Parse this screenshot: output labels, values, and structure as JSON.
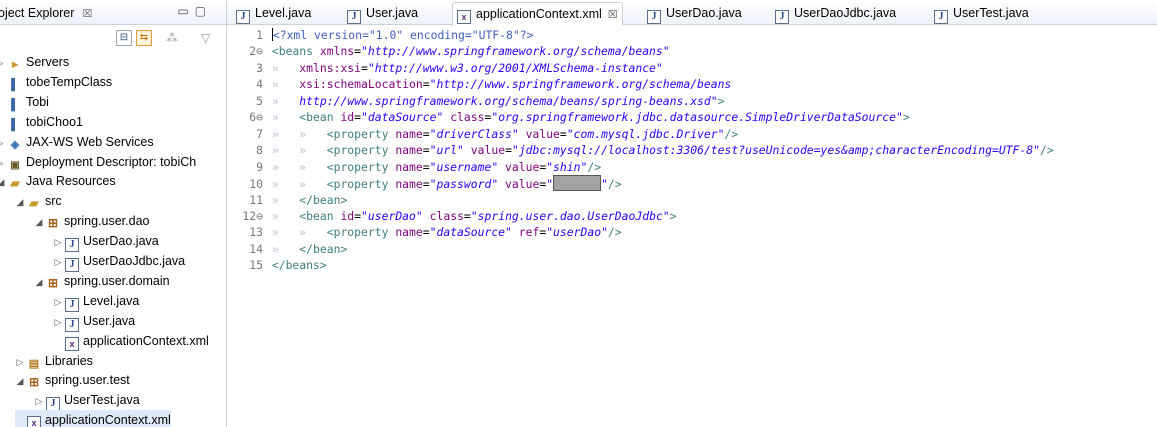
{
  "explorer": {
    "title": "oject Explorer",
    "close": "☒",
    "minimize": "▭",
    "maximize": "▢",
    "tree": [
      {
        "label": "Servers",
        "icon": "folder-icon",
        "twisty": "▹",
        "indent": 0
      },
      {
        "label": "tobeTempClass",
        "icon": "project-icon",
        "twisty": "",
        "indent": 0
      },
      {
        "label": "Tobi",
        "icon": "project-icon",
        "twisty": "",
        "indent": 0
      },
      {
        "label": "tobiChoo1",
        "icon": "project-icon",
        "twisty": "",
        "indent": 0
      },
      {
        "label": "JAX-WS Web Services",
        "icon": "webservice-icon",
        "twisty": "▹",
        "indent": 0
      },
      {
        "label": "Deployment Descriptor: tobiCh",
        "icon": "descriptor-icon",
        "twisty": "▹",
        "indent": 0
      },
      {
        "label": "Java Resources",
        "icon": "java-resources-icon",
        "twisty": "◢",
        "indent": 0
      },
      {
        "label": "src",
        "icon": "source-folder-icon",
        "twisty": "◢",
        "indent": 1
      },
      {
        "label": "spring.user.dao",
        "icon": "package-icon",
        "twisty": "◢",
        "indent": 2
      },
      {
        "label": "UserDao.java",
        "icon": "java-file-icon",
        "twisty": "▷",
        "indent": 3
      },
      {
        "label": "UserDaoJdbc.java",
        "icon": "java-file-icon",
        "twisty": "▷",
        "indent": 3
      },
      {
        "label": "spring.user.domain",
        "icon": "package-icon",
        "twisty": "◢",
        "indent": 2
      },
      {
        "label": "Level.java",
        "icon": "java-file-icon",
        "twisty": "▷",
        "indent": 3
      },
      {
        "label": "User.java",
        "icon": "java-file-icon",
        "twisty": "▷",
        "indent": 3
      },
      {
        "label": "applicationContext.xml",
        "icon": "xml-file-icon",
        "twisty": "",
        "indent": 3
      },
      {
        "label": "Libraries",
        "icon": "libraries-icon",
        "twisty": "▷",
        "indent": 1
      },
      {
        "label": "spring.user.test",
        "icon": "package-icon",
        "twisty": "◢",
        "indent": 1
      },
      {
        "label": "UserTest.java",
        "icon": "java-file-icon",
        "twisty": "▷",
        "indent": 2
      },
      {
        "label": "applicationContext.xml",
        "icon": "xml-file-icon",
        "twisty": "",
        "indent": 1,
        "selected": true
      }
    ]
  },
  "tabs": [
    {
      "label": "Level.java",
      "icon": "java-file-icon",
      "active": false
    },
    {
      "label": "User.java",
      "icon": "java-file-icon",
      "active": false
    },
    {
      "label": "applicationContext.xml",
      "icon": "xml-file-icon",
      "active": true,
      "close": "☒"
    },
    {
      "label": "UserDao.java",
      "icon": "java-file-icon",
      "active": false
    },
    {
      "label": "UserDaoJdbc.java",
      "icon": "java-file-icon",
      "active": false
    },
    {
      "label": "UserTest.java",
      "icon": "java-file-icon",
      "active": false
    }
  ],
  "code": {
    "line_numbers": [
      "1",
      "2⊖",
      "3",
      "4",
      "5",
      "6⊖",
      "7",
      "8",
      "9",
      "10",
      "11",
      "12⊖",
      "13",
      "14",
      "15"
    ],
    "lines": [
      [
        [
          "pi",
          "<?xml version=\"1.0\" encoding=\"UTF-8\"?>"
        ]
      ],
      [
        [
          "tag",
          "<beans "
        ],
        [
          "attr",
          "xmlns"
        ],
        [
          "txt",
          "="
        ],
        [
          "val",
          "\"http://www.springframework.org/schema/beans\""
        ]
      ],
      [
        [
          "ws",
          "»   "
        ],
        [
          "attr",
          "xmlns:xsi"
        ],
        [
          "txt",
          "="
        ],
        [
          "val",
          "\"http://www.w3.org/2001/XMLSchema-instance\""
        ]
      ],
      [
        [
          "ws",
          "»   "
        ],
        [
          "attr",
          "xsi:schemaLocation"
        ],
        [
          "txt",
          "="
        ],
        [
          "val",
          "\"http://www.springframework.org/schema/beans"
        ]
      ],
      [
        [
          "ws",
          "»   "
        ],
        [
          "val",
          "http://www.springframework.org/schema/beans/spring-beans.xsd\""
        ],
        [
          "tag",
          ">"
        ]
      ],
      [
        [
          "ws",
          "»   "
        ],
        [
          "tag",
          "<bean "
        ],
        [
          "attr",
          "id"
        ],
        [
          "txt",
          "="
        ],
        [
          "val",
          "\"dataSource\""
        ],
        [
          "txt",
          " "
        ],
        [
          "attr",
          "class"
        ],
        [
          "txt",
          "="
        ],
        [
          "val",
          "\"org.springframework.jdbc.datasource.SimpleDriverDataSource\""
        ],
        [
          "tag",
          ">"
        ]
      ],
      [
        [
          "ws",
          "»   »   "
        ],
        [
          "tag",
          "<property "
        ],
        [
          "attr",
          "name"
        ],
        [
          "txt",
          "="
        ],
        [
          "val",
          "\"driverClass\""
        ],
        [
          "txt",
          " "
        ],
        [
          "attr",
          "value"
        ],
        [
          "txt",
          "="
        ],
        [
          "val",
          "\"com.mysql.jdbc.Driver\""
        ],
        [
          "tag",
          "/>"
        ]
      ],
      [
        [
          "ws",
          "»   »   "
        ],
        [
          "tag",
          "<property "
        ],
        [
          "attr",
          "name"
        ],
        [
          "txt",
          "="
        ],
        [
          "val",
          "\"url\""
        ],
        [
          "txt",
          " "
        ],
        [
          "attr",
          "value"
        ],
        [
          "txt",
          "="
        ],
        [
          "val",
          "\"jdbc:mysql://localhost:3306/test?useUnicode=yes&amp;characterEncoding=UTF-8\""
        ],
        [
          "tag",
          "/>"
        ]
      ],
      [
        [
          "ws",
          "»   »   "
        ],
        [
          "tag",
          "<property "
        ],
        [
          "attr",
          "name"
        ],
        [
          "txt",
          "="
        ],
        [
          "val",
          "\"username\""
        ],
        [
          "txt",
          " "
        ],
        [
          "attr",
          "value"
        ],
        [
          "txt",
          "="
        ],
        [
          "val",
          "\"shin\""
        ],
        [
          "tag",
          "/>"
        ]
      ],
      [
        [
          "ws",
          "»   »   "
        ],
        [
          "tag",
          "<property "
        ],
        [
          "attr",
          "name"
        ],
        [
          "txt",
          "="
        ],
        [
          "val",
          "\"password\""
        ],
        [
          "txt",
          " "
        ],
        [
          "attr",
          "value"
        ],
        [
          "txt",
          "="
        ],
        [
          "val",
          "\""
        ],
        [
          "mask",
          ""
        ],
        [
          "val",
          "\""
        ],
        [
          "tag",
          "/>"
        ]
      ],
      [
        [
          "ws",
          "»   "
        ],
        [
          "tag",
          "</bean>"
        ]
      ],
      [
        [
          "ws",
          "»   "
        ],
        [
          "tag",
          "<bean "
        ],
        [
          "attr",
          "id"
        ],
        [
          "txt",
          "="
        ],
        [
          "val",
          "\"userDao\""
        ],
        [
          "txt",
          " "
        ],
        [
          "attr",
          "class"
        ],
        [
          "txt",
          "="
        ],
        [
          "val",
          "\"spring.user.dao.UserDaoJdbc\""
        ],
        [
          "tag",
          ">"
        ]
      ],
      [
        [
          "ws",
          "»   »   "
        ],
        [
          "tag",
          "<property "
        ],
        [
          "attr",
          "name"
        ],
        [
          "txt",
          "="
        ],
        [
          "val",
          "\"dataSource\""
        ],
        [
          "txt",
          " "
        ],
        [
          "attr",
          "ref"
        ],
        [
          "txt",
          "="
        ],
        [
          "val",
          "\"userDao\""
        ],
        [
          "tag",
          "/>"
        ]
      ],
      [
        [
          "ws",
          "»   "
        ],
        [
          "tag",
          "</bean>"
        ]
      ],
      [
        [
          "tag",
          "</beans>"
        ]
      ]
    ]
  },
  "colors": {
    "tag": "#3f7f7f",
    "attribute": "#7f007f",
    "value": "#2a00ff",
    "selection": "#dfe9f7"
  }
}
